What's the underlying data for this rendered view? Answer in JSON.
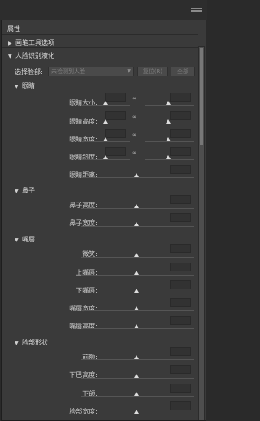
{
  "panel": {
    "title": "属性"
  },
  "sections": {
    "brush": "画笔工具选项",
    "face": "人脸识别液化"
  },
  "select_face": {
    "label": "选择脸部:",
    "value": "未检测到人脸",
    "reset": "复位(R)",
    "all": "全部"
  },
  "groups": {
    "eyes": "眼睛",
    "nose": "鼻子",
    "mouth": "嘴唇",
    "face_shape": "脸部形状"
  },
  "sliders": {
    "eye_size": "眼睛大小:",
    "eye_height": "眼睛高度:",
    "eye_width": "眼睛宽度:",
    "eye_tilt": "眼睛斜度:",
    "eye_distance": "眼睛距离:",
    "nose_height": "鼻子高度:",
    "nose_width": "鼻子宽度:",
    "smile": "微笑:",
    "upper_lip": "上嘴唇:",
    "lower_lip": "下嘴唇:",
    "mouth_width": "嘴唇宽度:",
    "mouth_height": "嘴唇高度:",
    "forehead": "前额:",
    "chin_height": "下巴高度:",
    "jawline": "下颌:",
    "face_width": "脸部宽度:"
  },
  "icons": {
    "link": "chain-link-icon",
    "collapse": "triangle-down-icon",
    "expand": "triangle-right-icon"
  }
}
